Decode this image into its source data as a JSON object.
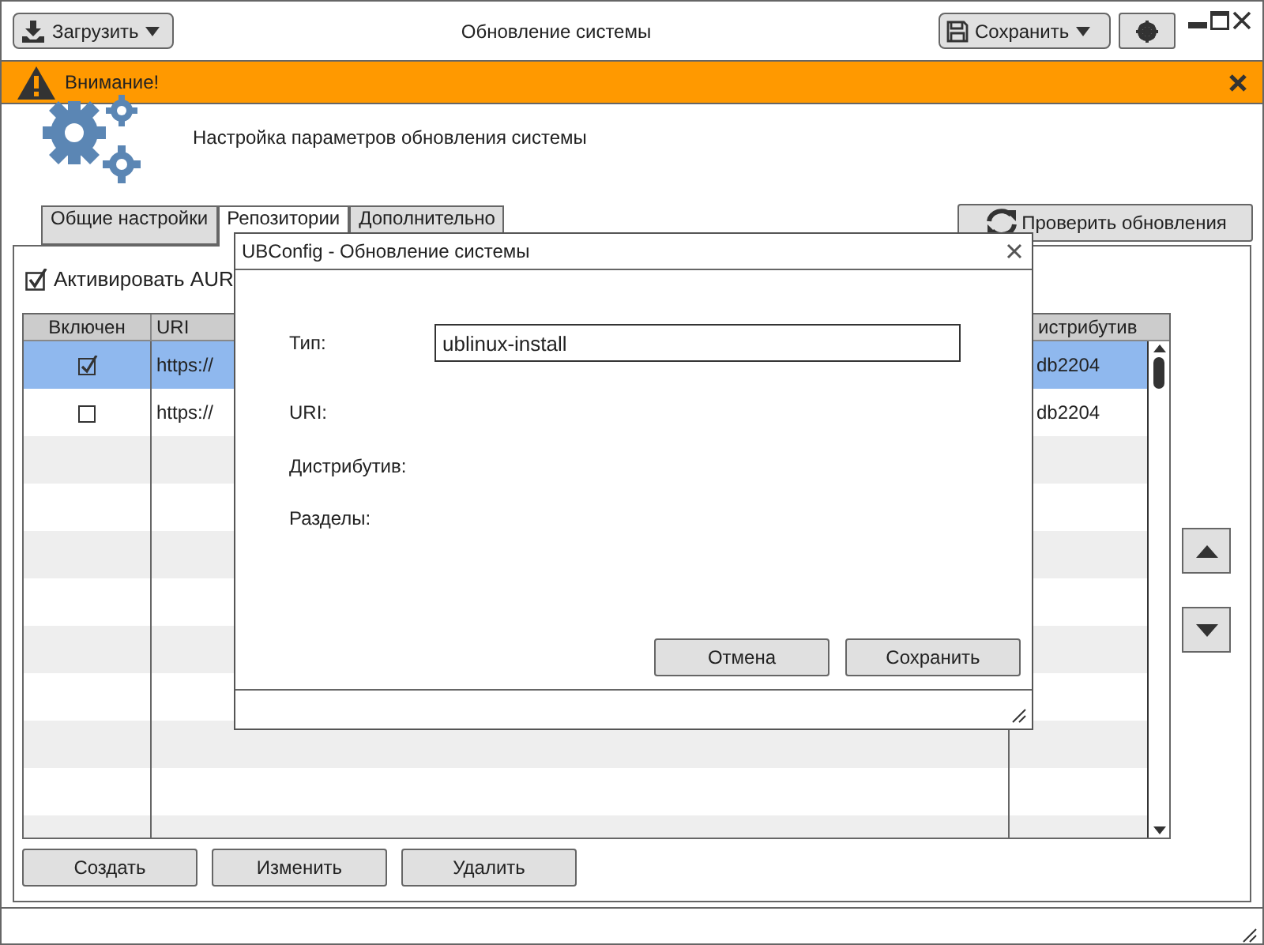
{
  "window": {
    "title": "Обновление системы"
  },
  "toolbar": {
    "load_button": "Загрузить",
    "save_button": "Сохранить"
  },
  "warning": {
    "text": "Внимание!"
  },
  "header": {
    "text": "Настройка параметров обновления системы"
  },
  "tabs": [
    {
      "label": "Общие настройки",
      "selected": false
    },
    {
      "label": "Репозитории",
      "selected": true
    },
    {
      "label": "Дополнительно",
      "selected": false
    }
  ],
  "check_updates_button": "Проверить обновления",
  "aur": {
    "label": "Активировать AUR",
    "checked": true
  },
  "table": {
    "columns": [
      "Включен",
      "URI",
      "истрибутив"
    ],
    "rows": [
      {
        "enabled": true,
        "selected": true,
        "uri": "https://",
        "distribution": "db2204"
      },
      {
        "enabled": false,
        "selected": false,
        "uri": "https://",
        "distribution": "db2204"
      }
    ]
  },
  "buttons": [
    "Создать",
    "Изменить",
    "Удалить"
  ],
  "dialog": {
    "title": "UBConfig - Обновление системы",
    "fields": [
      {
        "kind": "input",
        "label": "Тип:",
        "value": "ublinux-install"
      },
      {
        "kind": "label",
        "label": "URI:"
      },
      {
        "kind": "label",
        "label": "Дистрибутив:"
      },
      {
        "kind": "label",
        "label": "Разделы:"
      }
    ],
    "buttons": [
      "Отмена",
      "Сохранить"
    ]
  }
}
